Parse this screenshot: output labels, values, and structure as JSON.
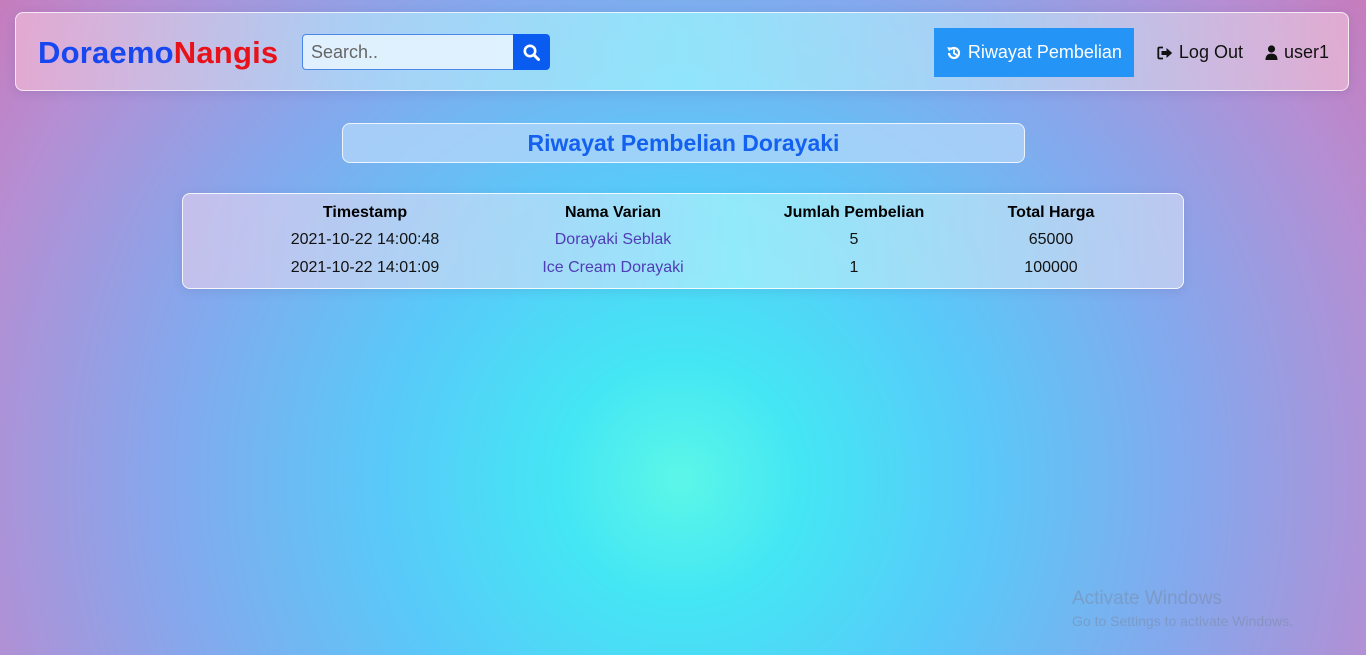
{
  "navbar": {
    "brand_part1": "Doraemo",
    "brand_part2": "Nangis",
    "search": {
      "placeholder": "Search..",
      "value": "",
      "button_icon": "search-icon"
    },
    "history_button": {
      "label": "Riwayat Pembelian",
      "icon": "history-icon"
    },
    "logout": {
      "label": "Log Out",
      "icon": "sign-out-icon"
    },
    "user": {
      "label": "user1",
      "icon": "user-icon"
    }
  },
  "page": {
    "title": "Riwayat Pembelian Dorayaki"
  },
  "table": {
    "headers": [
      "Timestamp",
      "Nama Varian",
      "Jumlah Pembelian",
      "Total Harga"
    ],
    "rows": [
      {
        "timestamp": "2021-10-22 14:00:48",
        "variant": "Dorayaki Seblak",
        "quantity": "5",
        "total": "65000"
      },
      {
        "timestamp": "2021-10-22 14:01:09",
        "variant": "Ice Cream Dorayaki",
        "quantity": "1",
        "total": "100000"
      }
    ]
  },
  "watermark": {
    "line1": "Activate Windows",
    "line2": "Go to Settings to activate Windows."
  },
  "colors": {
    "brand_blue": "#1747f0",
    "brand_red": "#e8121b",
    "primary_button": "#2494f7",
    "search_button": "#0a5cf0",
    "title_text": "#1461f0",
    "link_text": "#4f3db6"
  }
}
